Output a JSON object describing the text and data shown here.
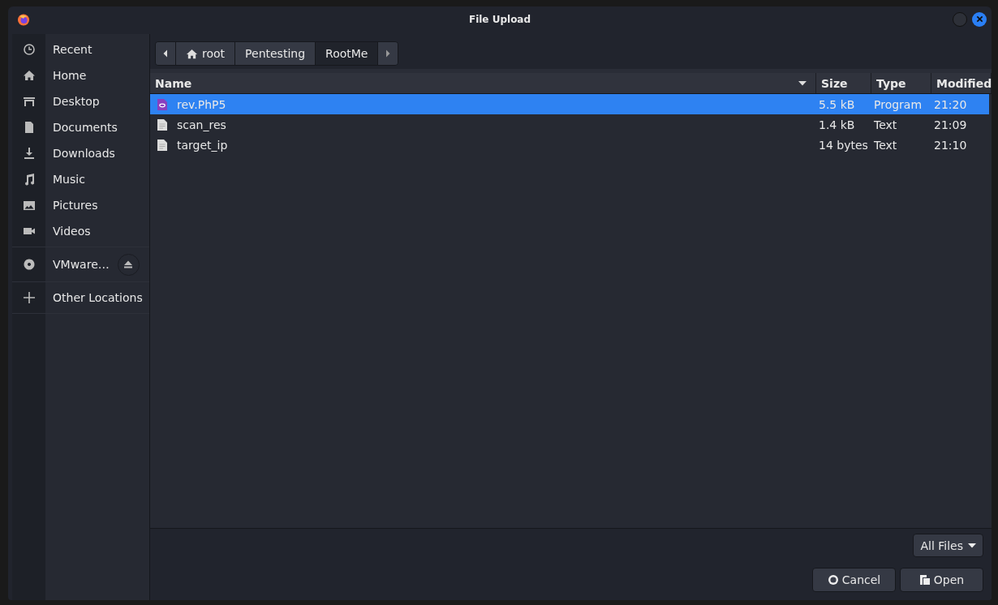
{
  "window": {
    "title": "File Upload"
  },
  "sidebar": {
    "items": [
      {
        "label": "Recent",
        "kind": "recent"
      },
      {
        "label": "Home",
        "kind": "home"
      },
      {
        "label": "Desktop",
        "kind": "desktop"
      },
      {
        "label": "Documents",
        "kind": "documents"
      },
      {
        "label": "Downloads",
        "kind": "downloads"
      },
      {
        "label": "Music",
        "kind": "music"
      },
      {
        "label": "Pictures",
        "kind": "pictures"
      },
      {
        "label": "Videos",
        "kind": "videos"
      },
      {
        "label": "VMware…",
        "kind": "drive"
      },
      {
        "label": "Other Locations",
        "kind": "other"
      }
    ]
  },
  "path_bar": {
    "segments": [
      {
        "label": "root",
        "selected": false
      },
      {
        "label": "Pentesting",
        "selected": false
      },
      {
        "label": "RootMe",
        "selected": true
      }
    ]
  },
  "table": {
    "columns": [
      "Name",
      "Size",
      "Type",
      "Modified"
    ],
    "rows": [
      {
        "name": "rev.PhP5",
        "size": "5.5 kB",
        "type": "Program",
        "modified": "21:20",
        "kind": "program",
        "selected": true
      },
      {
        "name": "scan_res",
        "size": "1.4 kB",
        "type": "Text",
        "modified": "21:09",
        "kind": "text",
        "selected": false
      },
      {
        "name": "target_ip",
        "size": "14 bytes",
        "type": "Text",
        "modified": "21:10",
        "kind": "text",
        "selected": false
      }
    ]
  },
  "filter": {
    "value": "All Files"
  },
  "buttons": [
    "Cancel",
    "Open"
  ]
}
